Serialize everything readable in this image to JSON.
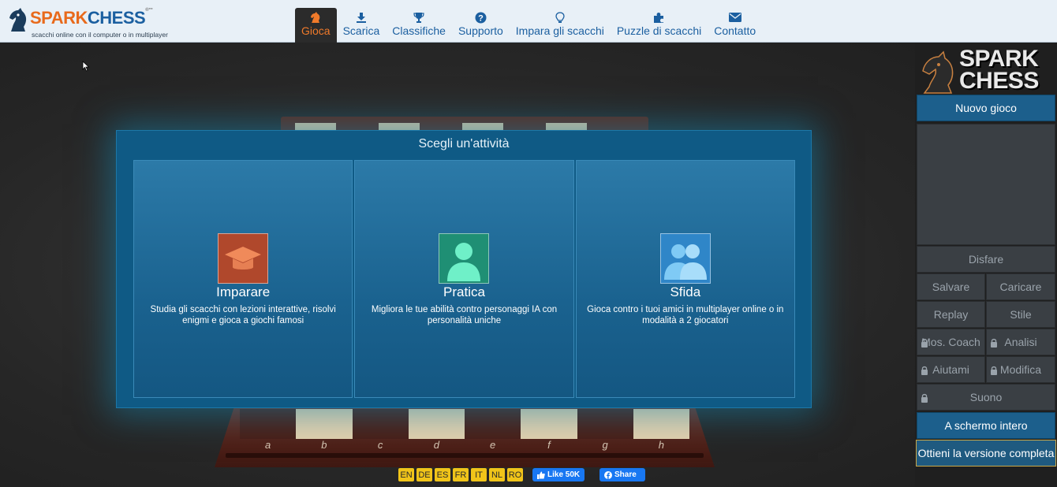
{
  "brand": {
    "logo_text_left": "SPARK",
    "logo_text_right": "CHESS",
    "trademark": "®™",
    "tagline": "scacchi online con il computer o in multiplayer"
  },
  "nav": [
    {
      "label": "Gioca",
      "icon": "knight-icon",
      "active": true
    },
    {
      "label": "Scarica",
      "icon": "download-icon"
    },
    {
      "label": "Classifiche",
      "icon": "trophy-icon"
    },
    {
      "label": "Supporto",
      "icon": "question-icon"
    },
    {
      "label": "Impara gli scacchi",
      "icon": "lightbulb-icon"
    },
    {
      "label": "Puzzle di scacchi",
      "icon": "puzzle-icon"
    },
    {
      "label": "Contatto",
      "icon": "envelope-icon"
    }
  ],
  "modal": {
    "title": "Scegli un'attività",
    "cards": [
      {
        "title": "Imparare",
        "desc": "Studia gli scacchi con lezioni interattive, risolvi enigmi e gioca a giochi famosi",
        "icon": "graduation-cap-icon",
        "color": "#b0482c"
      },
      {
        "title": "Pratica",
        "desc": "Migliora le tue abilità contro personaggi IA con personalità uniche",
        "icon": "person-icon",
        "color": "#2fb394"
      },
      {
        "title": "Sfida",
        "desc": "Gioca contro i tuoi amici in multiplayer online o in modalità a 2 giocatori",
        "icon": "two-people-icon",
        "color": "#2f86c8"
      }
    ]
  },
  "board": {
    "files": [
      "a",
      "b",
      "c",
      "d",
      "e",
      "f",
      "g",
      "h"
    ]
  },
  "panel": {
    "logo_line1": "SPARK",
    "logo_line2": "CHESS",
    "new_game": "Nuovo gioco",
    "undo": "Disfare",
    "save": "Salvare",
    "load": "Caricare",
    "replay": "Replay",
    "style": "Stile",
    "coach": "Mos. Coach",
    "analysis": "Analisi",
    "hints": "Aiutami",
    "edit": "Modifica",
    "sound": "Suono",
    "fullscreen": "A schermo intero",
    "get_full": "Ottieni la versione completa"
  },
  "footer": {
    "languages": [
      "EN",
      "DE",
      "ES",
      "FR",
      "IT",
      "NL",
      "RO"
    ],
    "fb_like": "Like 50K",
    "fb_share": "Share"
  },
  "colors": {
    "accent_orange": "#f07a2a",
    "nav_blue": "#1b5fa0",
    "modal_blue": "#0f5a85",
    "lang_yellow": "#f0c419",
    "fb_blue": "#1877f2"
  }
}
